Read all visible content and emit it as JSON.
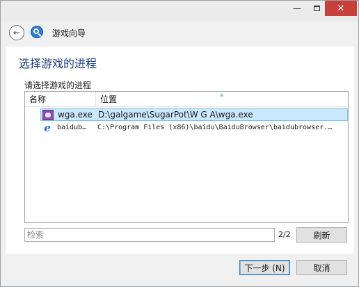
{
  "window": {
    "controls": {
      "minimize": "—",
      "close": "✕"
    }
  },
  "nav": {
    "back_glyph": "←",
    "title": "游戏向导"
  },
  "page": {
    "heading": "选择游戏的进程",
    "list_label": "请选择游戏的进程"
  },
  "list": {
    "columns": [
      "名称",
      "位置"
    ],
    "sort_glyph": "▲",
    "rows": [
      {
        "name": "wga.exe",
        "path": "D:\\galgame\\SugarPot\\W G A\\wga.exe",
        "icon": "wga-app-icon",
        "selected": true
      },
      {
        "name": "baidub…",
        "path": "C:\\Program Files (x86)\\baidu\\BaiduBrowser\\baidubrowser.…",
        "icon": "ie-e-icon",
        "selected": false
      }
    ]
  },
  "search": {
    "placeholder": "检索",
    "count": "2/2",
    "refresh_label": "刷新"
  },
  "buttons": {
    "next_label": "下一步 (N)",
    "cancel_label": "取消"
  },
  "colors": {
    "heading": "#1c3c8c",
    "selection": "#cce8ff",
    "close": "#c7403a"
  }
}
